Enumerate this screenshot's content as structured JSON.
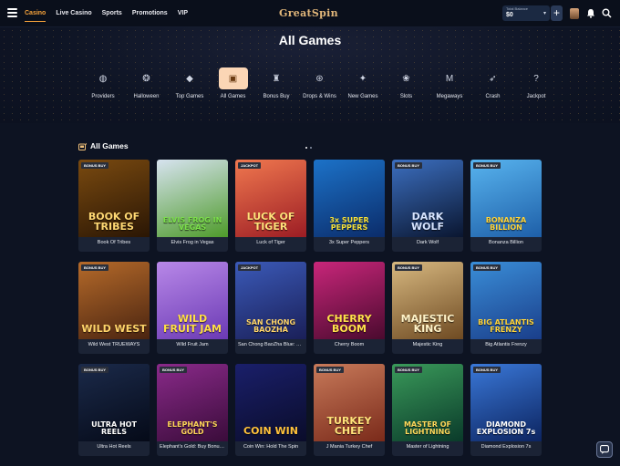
{
  "header": {
    "nav": [
      "Casino",
      "Live Casino",
      "Sports",
      "Promotions",
      "VIP"
    ],
    "logo": "GreatSpin",
    "balance_label": "Total Balance",
    "balance_value": "$0",
    "deposit_label": "+"
  },
  "hero": {
    "title": "All Games",
    "categories": [
      {
        "label": "Providers",
        "icon": "providers-icon"
      },
      {
        "label": "Halloween",
        "icon": "pumpkin-icon"
      },
      {
        "label": "Top Games",
        "icon": "diamond-icon"
      },
      {
        "label": "All Games",
        "icon": "slot-machine-icon",
        "active": true
      },
      {
        "label": "Bonus Buy",
        "icon": "money-bag-icon"
      },
      {
        "label": "Drops & Wins",
        "icon": "chip-icon"
      },
      {
        "label": "New Games",
        "icon": "new-star-icon"
      },
      {
        "label": "Slots",
        "icon": "cherry-icon"
      },
      {
        "label": "Megaways",
        "icon": "megaways-icon"
      },
      {
        "label": "Crash",
        "icon": "rocket-icon"
      },
      {
        "label": "Jackpot",
        "icon": "question-icon"
      }
    ]
  },
  "section": {
    "title": "All Games"
  },
  "games": [
    {
      "name": "Book Of Tribes",
      "badge": "BONUS BUY",
      "art": "BOOK OF TRIBES",
      "bg1": "#7a4a10",
      "bg2": "#2a1604",
      "color": "#ffd873"
    },
    {
      "name": "Elvis Frog in Vegas",
      "badge": "",
      "art": "ELVIS FROG IN VEGAS",
      "bg1": "#d7e3f0",
      "bg2": "#4e9b2a",
      "color": "#7be04a"
    },
    {
      "name": "Luck of Tiger",
      "badge": "JACKPOT",
      "art": "LUCK OF TIGER",
      "bg1": "#f0784f",
      "bg2": "#9c1d24",
      "color": "#ffe07a"
    },
    {
      "name": "3x Super Peppers",
      "badge": "",
      "art": "3x SUPER PEPPERS",
      "bg1": "#1c72c8",
      "bg2": "#0b2c6a",
      "color": "#f7e23b"
    },
    {
      "name": "Dark Wolf",
      "badge": "BONUS BUY",
      "art": "DARK WOLF",
      "bg1": "#3c6fc0",
      "bg2": "#0a1630",
      "color": "#d6e4ff"
    },
    {
      "name": "Bonanza Billion",
      "badge": "BONUS BUY",
      "art": "BONANZA BILLION",
      "bg1": "#58b4ef",
      "bg2": "#1e5fa8",
      "color": "#ffd43a"
    },
    {
      "name": "Wild West TRUEWAYS",
      "badge": "BONUS BUY",
      "art": "WILD WEST",
      "bg1": "#b56a2a",
      "bg2": "#4a2410",
      "color": "#ffd56a"
    },
    {
      "name": "Wild Fruit Jam",
      "badge": "",
      "art": "WILD FRUIT JAM",
      "bg1": "#b888e8",
      "bg2": "#6b3ab4",
      "color": "#ffdf45"
    },
    {
      "name": "San Chong BaoZha Blue: Bo...",
      "badge": "JACKPOT",
      "art": "SAN CHONG BAOZHA",
      "bg1": "#3b5ab8",
      "bg2": "#1a1f58",
      "color": "#ffd56a"
    },
    {
      "name": "Cherry Boom",
      "badge": "",
      "art": "CHERRY BOOM",
      "bg1": "#c8267a",
      "bg2": "#4a0a2e",
      "color": "#ffe14a"
    },
    {
      "name": "Majestic King",
      "badge": "BONUS BUY",
      "art": "MAJESTIC KING",
      "bg1": "#d7b880",
      "bg2": "#6e4a22",
      "color": "#fff3c8"
    },
    {
      "name": "Big Atlantis Frenzy",
      "badge": "BONUS BUY",
      "art": "BIG ATLANTIS FRENZY",
      "bg1": "#3a8ed8",
      "bg2": "#1a3e8a",
      "color": "#ffd43a"
    },
    {
      "name": "Ultra Hot Reels",
      "badge": "BONUS BUY",
      "art": "ULTRA HOT REELS",
      "bg1": "#1b2a4a",
      "bg2": "#050a18",
      "color": "#ffffff"
    },
    {
      "name": "Elephant's Gold: Buy Bonus ...",
      "badge": "BONUS BUY",
      "art": "ELEPHANT'S GOLD",
      "bg1": "#8a2a8a",
      "bg2": "#3a0c3a",
      "color": "#ffd45a"
    },
    {
      "name": "Coin Win: Hold The Spin",
      "badge": "",
      "art": "COIN WIN",
      "bg1": "#1a1f6a",
      "bg2": "#0a0c2a",
      "color": "#ffc23a"
    },
    {
      "name": "J Mania Turkey Chef",
      "badge": "BONUS BUY",
      "art": "TURKEY CHEF",
      "bg1": "#c87a5a",
      "bg2": "#7a2a1a",
      "color": "#ffe27a"
    },
    {
      "name": "Master of Lightning",
      "badge": "BONUS BUY",
      "art": "MASTER OF LIGHTNING",
      "bg1": "#3a9a5a",
      "bg2": "#0a3a2a",
      "color": "#ffd85a"
    },
    {
      "name": "Diamond Explosion 7s",
      "badge": "BONUS BUY",
      "art": "DIAMOND EXPLOSION 7s",
      "bg1": "#3a78d8",
      "bg2": "#0c2460",
      "color": "#ffffff"
    }
  ]
}
